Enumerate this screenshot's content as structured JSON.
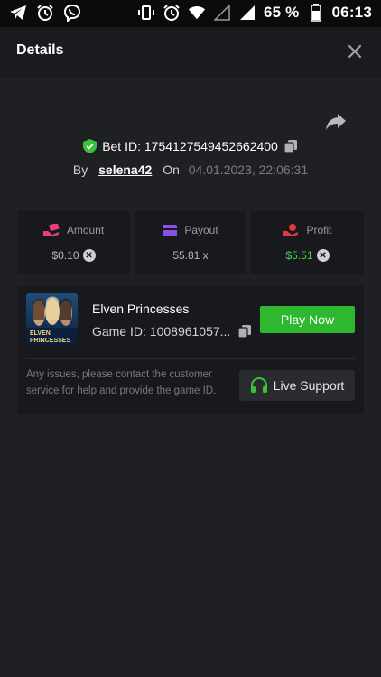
{
  "status_bar": {
    "battery_percent": "65 %",
    "time": "06:13"
  },
  "header": {
    "title": "Details"
  },
  "bet": {
    "bet_id": "Bet ID: 1754127549452662400",
    "by_label": "By",
    "username": "selena42",
    "on_label": "On",
    "datetime": "04.01.2023, 22:06:31"
  },
  "stats": [
    {
      "label": "Amount",
      "value": "$0.10",
      "icon": "money-hand-icon"
    },
    {
      "label": "Payout",
      "value": "55.81 x",
      "icon": "card-icon"
    },
    {
      "label": "Profit",
      "value": "$5.51",
      "icon": "profit-hand-icon"
    }
  ],
  "game": {
    "name": "Elven Princesses",
    "game_id": "Game ID: 1008961057...",
    "thumb_text_1": "ELVEN",
    "thumb_text_2": "PRINCESSES",
    "play_label": "Play Now",
    "issue_text": "Any issues, please contact the customer service for help and provide the game ID.",
    "support_label": "Live Support"
  },
  "colors": {
    "background": "#1f2024",
    "card": "#18191c",
    "accent_green": "#2eb82f",
    "profit_green": "#49d24a",
    "amount_pink": "#e8407a",
    "payout_purple": "#8b4fe6",
    "profit_red": "#e03a3a"
  }
}
